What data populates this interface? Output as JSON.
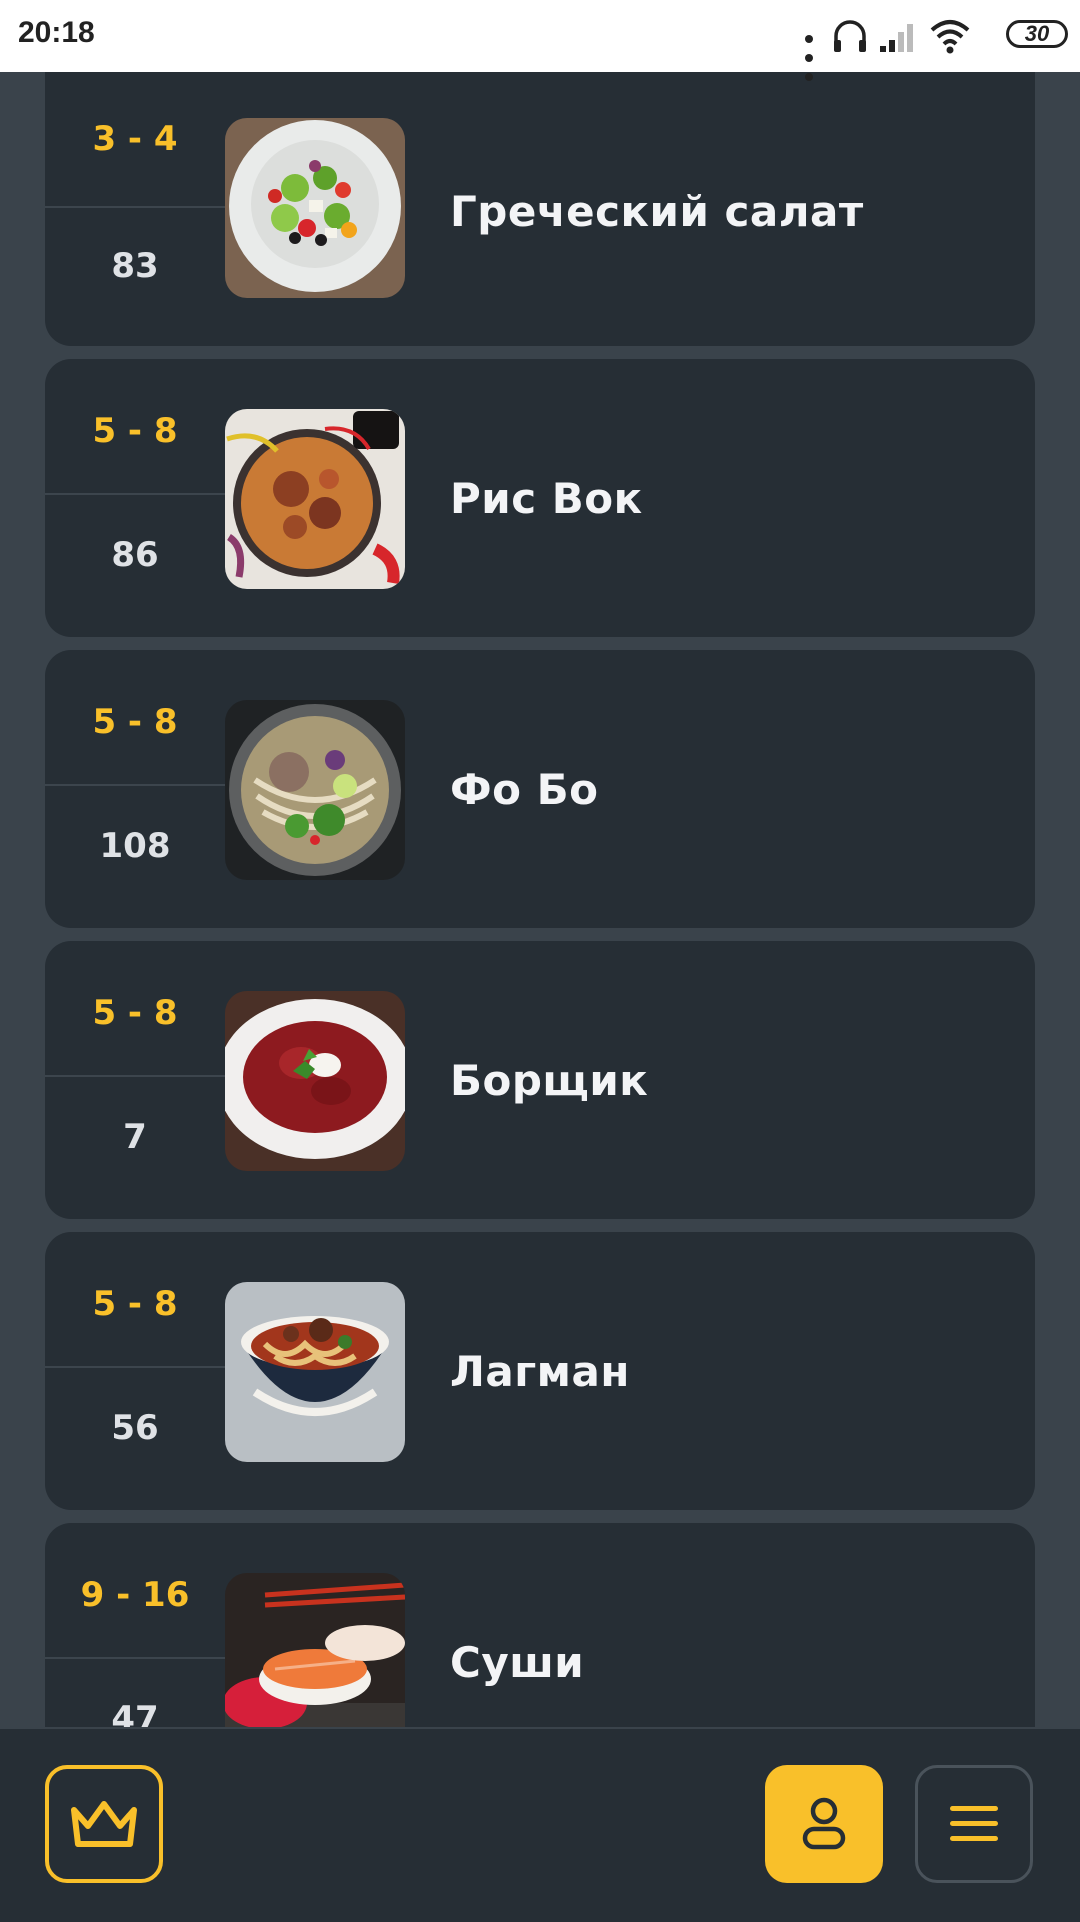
{
  "status_bar": {
    "time": "20:18",
    "battery": "30",
    "icons": [
      "more-dots-icon",
      "headset-icon",
      "signal-icon",
      "wifi-icon",
      "battery-icon"
    ]
  },
  "dishes": [
    {
      "range": "3 - 4",
      "count": "83",
      "name": "Греческий салат",
      "image": "greek-salad"
    },
    {
      "range": "5 - 8",
      "count": "86",
      "name": "Рис Вок",
      "image": "rice-wok"
    },
    {
      "range": "5 - 8",
      "count": "108",
      "name": "Фо Бо",
      "image": "pho-bo"
    },
    {
      "range": "5 - 8",
      "count": "7",
      "name": "Борщик",
      "image": "borscht"
    },
    {
      "range": "5 - 8",
      "count": "56",
      "name": "Лагман",
      "image": "lagman"
    },
    {
      "range": "9 - 16",
      "count": "47",
      "name": "Суши",
      "image": "sushi"
    }
  ],
  "bottom_nav": {
    "crown_icon": "crown-icon",
    "profile_icon": "user-icon",
    "menu_icon": "hamburger-icon"
  },
  "colors": {
    "accent": "#f9c02a",
    "card": "#262e35",
    "background": "#3a434b",
    "text": "#f3f4f6"
  }
}
